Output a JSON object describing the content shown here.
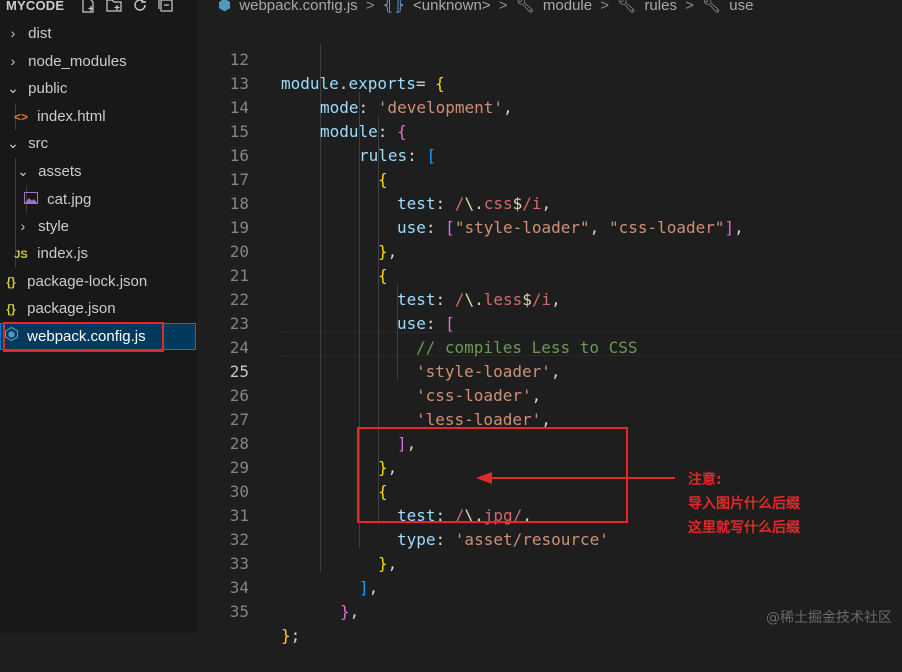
{
  "explorer": {
    "title": "MYCODE",
    "action_icons": [
      "new-file-icon",
      "new-folder-icon",
      "refresh-icon",
      "collapse-icon"
    ],
    "items": [
      {
        "label": "dist",
        "kind": "folder",
        "expanded": false
      },
      {
        "label": "node_modules",
        "kind": "folder",
        "expanded": false
      },
      {
        "label": "public",
        "kind": "folder",
        "expanded": true
      },
      {
        "label": "index.html",
        "kind": "html"
      },
      {
        "label": "src",
        "kind": "folder",
        "expanded": true
      },
      {
        "label": "assets",
        "kind": "folder",
        "expanded": true
      },
      {
        "label": "cat.jpg",
        "kind": "image"
      },
      {
        "label": "style",
        "kind": "folder",
        "expanded": false
      },
      {
        "label": "index.js",
        "kind": "js"
      },
      {
        "label": "package-lock.json",
        "kind": "json"
      },
      {
        "label": "package.json",
        "kind": "json"
      },
      {
        "label": "webpack.config.js",
        "kind": "webpack",
        "selected": true
      }
    ],
    "icon_glyphs": {
      "html": "<>",
      "js": "JS",
      "json": "{}"
    }
  },
  "breadcrumb": {
    "items": [
      "webpack.config.js",
      "<unknown>",
      "module",
      "rules",
      "use"
    ],
    "separator": ">"
  },
  "editor": {
    "active_line": 25,
    "line_numbers": [
      "12",
      "13",
      "14",
      "15",
      "16",
      "17",
      "18",
      "19",
      "20",
      "21",
      "22",
      "23",
      "24",
      "25",
      "26",
      "27",
      "28",
      "29",
      "30",
      "31",
      "32",
      "33",
      "34",
      "35"
    ],
    "code": {
      "l12_a": "module",
      "l12_b": ".",
      "l12_c": "exports",
      "l12_d": "= ",
      "l12_e": "{",
      "l13_a": "mode",
      "l13_b": ": ",
      "l13_c": "'development'",
      "l13_d": ",",
      "l14_a": "module",
      "l14_b": ": ",
      "l14_c": "{",
      "l15_a": "rules",
      "l15_b": ": ",
      "l15_c": "[",
      "l16_a": "{",
      "l17_a": "test",
      "l17_b": ": ",
      "l17_c": "/",
      "l17_d": "\\.",
      "l17_e": "css",
      "l17_f": "$",
      "l17_g": "/i",
      "l17_h": ",",
      "l18_a": "use",
      "l18_b": ": ",
      "l18_c": "[",
      "l18_d": "\"style-loader\"",
      "l18_e": ", ",
      "l18_f": "\"css-loader\"",
      "l18_g": "]",
      "l18_h": ",",
      "l19_a": "}",
      "l19_b": ",",
      "l20_a": "{",
      "l21_a": "test",
      "l21_b": ": ",
      "l21_c": "/",
      "l21_d": "\\.",
      "l21_e": "less",
      "l21_f": "$",
      "l21_g": "/i",
      "l21_h": ",",
      "l22_a": "use",
      "l22_b": ": ",
      "l22_c": "[",
      "l23_a": "// compiles Less to CSS",
      "l24_a": "'style-loader'",
      "l24_b": ",",
      "l25_a": "'css-loader'",
      "l25_b": ",",
      "l26_a": "'less-loader'",
      "l26_b": ",",
      "l27_a": "]",
      "l27_b": ",",
      "l28_a": "}",
      "l28_b": ",",
      "l29_a": "{",
      "l30_a": "test",
      "l30_b": ": ",
      "l30_c": "/",
      "l30_d": "\\.",
      "l30_e": "jpg",
      "l30_f": "/",
      "l30_g": ",",
      "l31_a": "type",
      "l31_b": ": ",
      "l31_c": "'asset/resource'",
      "l32_a": "}",
      "l32_b": ",",
      "l33_a": "]",
      "l33_b": ",",
      "l34_a": "}",
      "l34_b": ",",
      "l35_a": "}",
      "l35_b": ";"
    }
  },
  "annotation": {
    "lines": [
      "注意:",
      "导入图片什么后缀",
      "这里就写什么后缀"
    ],
    "color": "#e5262a"
  },
  "watermark": "@稀土掘金技术社区"
}
